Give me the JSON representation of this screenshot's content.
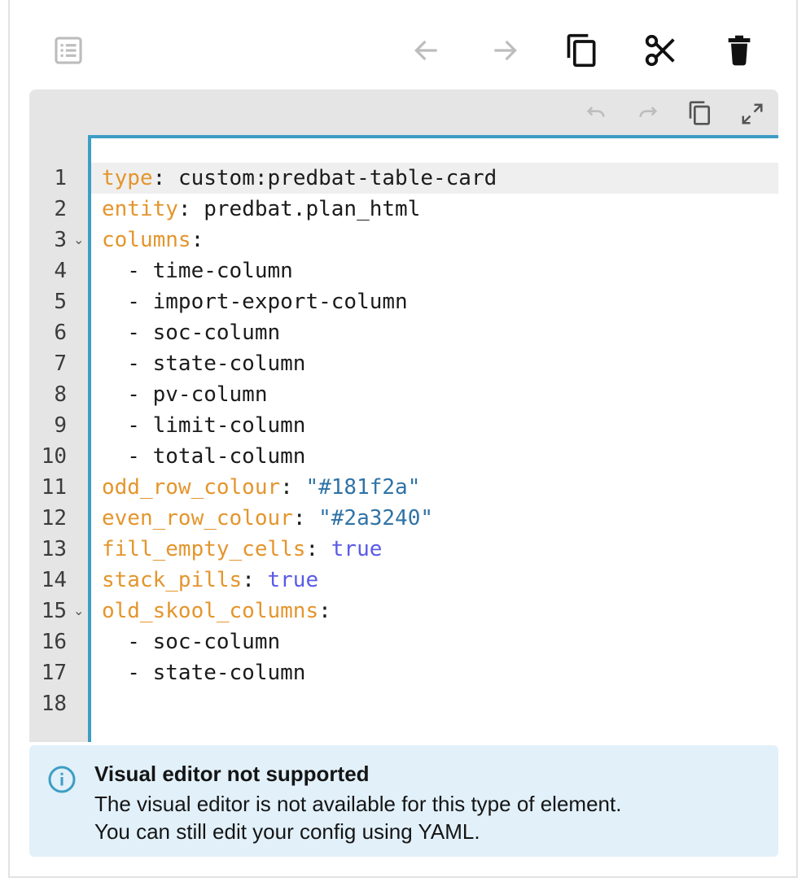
{
  "toolbar": {
    "icons": [
      "list-icon",
      "arrow-left-icon",
      "arrow-right-icon",
      "copy-icon",
      "cut-icon",
      "delete-icon"
    ]
  },
  "editor_toolbar": {
    "icons": [
      "undo-icon",
      "redo-icon",
      "copy-icon",
      "expand-icon"
    ]
  },
  "code": {
    "line_numbers": [
      "1",
      "2",
      "3",
      "4",
      "5",
      "6",
      "7",
      "8",
      "9",
      "10",
      "11",
      "12",
      "13",
      "14",
      "15",
      "16",
      "17",
      "18"
    ],
    "fold_marker": "⌄",
    "lines": [
      {
        "key": "type",
        "sep": ": ",
        "value": "custom:predbat-table-card",
        "value_type": "plain"
      },
      {
        "key": "entity",
        "sep": ": ",
        "value": "predbat.plan_html",
        "value_type": "plain"
      },
      {
        "key": "columns",
        "sep": ":",
        "value": "",
        "value_type": "plain"
      },
      {
        "item": "  - time-column"
      },
      {
        "item": "  - import-export-column"
      },
      {
        "item": "  - soc-column"
      },
      {
        "item": "  - state-column"
      },
      {
        "item": "  - pv-column"
      },
      {
        "item": "  - limit-column"
      },
      {
        "item": "  - total-column"
      },
      {
        "key": "odd_row_colour",
        "sep": ": ",
        "value": "\"#181f2a\"",
        "value_type": "string"
      },
      {
        "key": "even_row_colour",
        "sep": ": ",
        "value": "\"#2a3240\"",
        "value_type": "string"
      },
      {
        "key": "fill_empty_cells",
        "sep": ": ",
        "value": "true",
        "value_type": "bool"
      },
      {
        "key": "stack_pills",
        "sep": ": ",
        "value": "true",
        "value_type": "bool"
      },
      {
        "key": "old_skool_columns",
        "sep": ":",
        "value": "",
        "value_type": "plain"
      },
      {
        "item": "  - soc-column"
      },
      {
        "item": "  - state-column"
      },
      {
        "item": ""
      }
    ]
  },
  "alert": {
    "icon": "info-icon",
    "title": "Visual editor not supported",
    "line1": "The visual editor is not available for this type of element.",
    "line2": "You can still edit your config using YAML."
  },
  "colors": {
    "yaml_key": "#e4952c",
    "yaml_string": "#2f73a6",
    "yaml_bool": "#5a5ae8",
    "focus_border": "#3d9dc5",
    "alert_bg": "#e1f0f9",
    "info_icon": "#3d9dc5"
  }
}
